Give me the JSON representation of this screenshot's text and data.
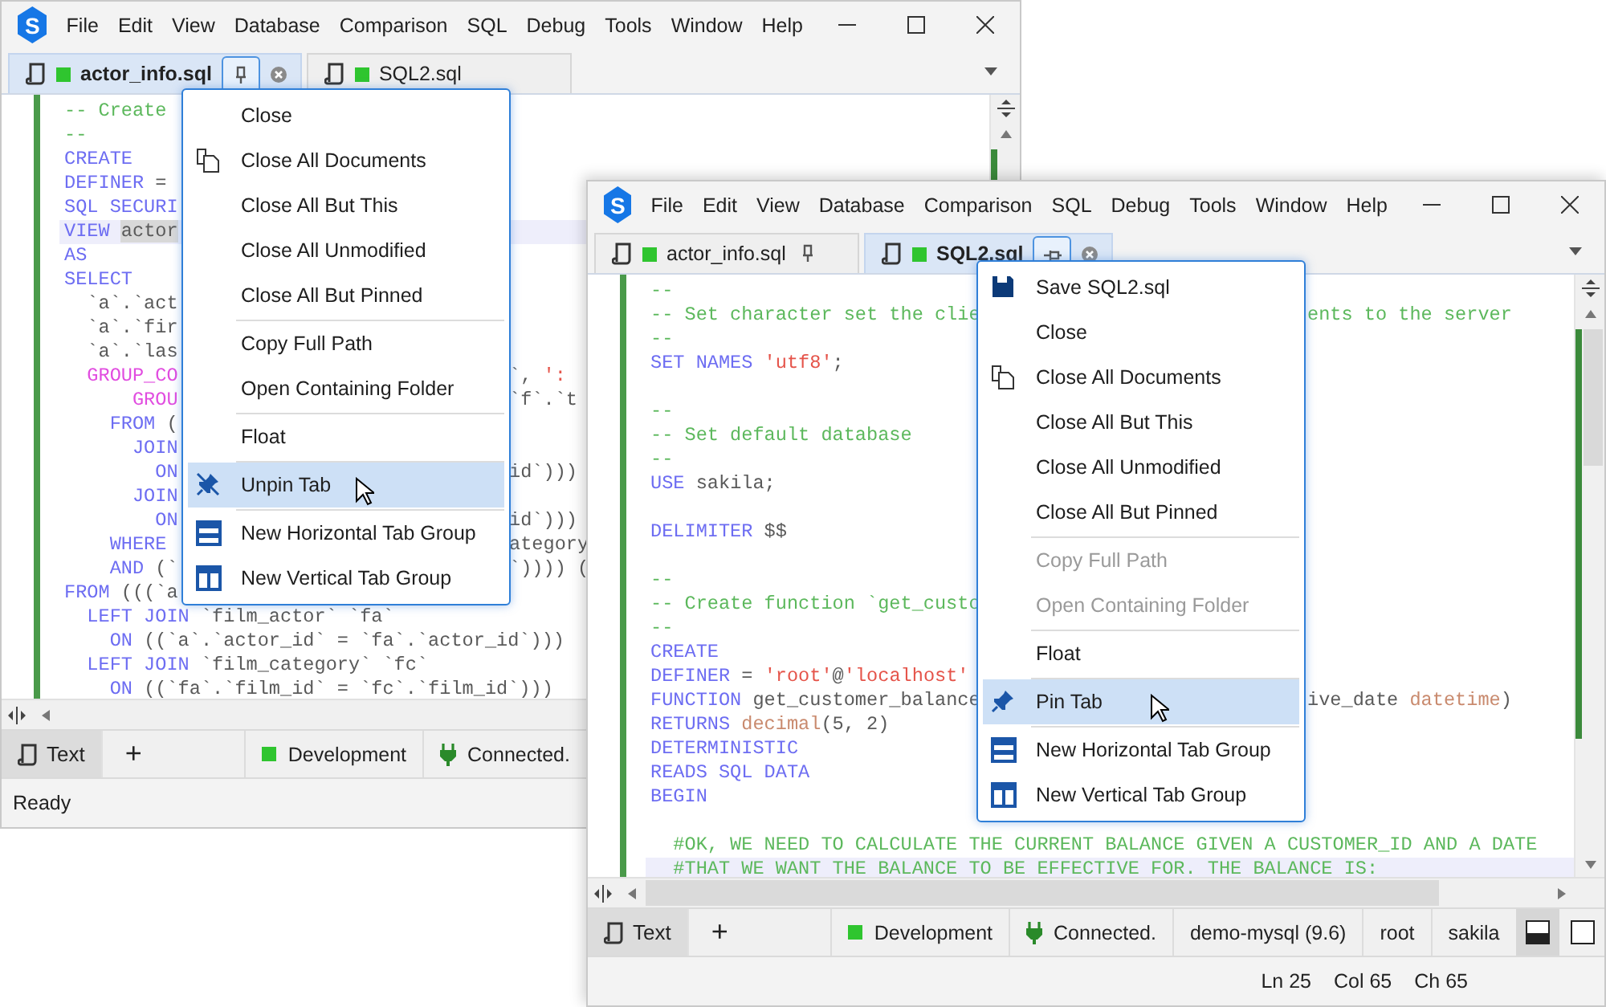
{
  "windows": [
    {
      "logo": "S",
      "menu": [
        "File",
        "Edit",
        "View",
        "Database",
        "Comparison",
        "SQL",
        "Debug",
        "Tools",
        "Window",
        "Help"
      ],
      "tabs": [
        {
          "label": "actor_info.sql",
          "selected": true,
          "pinned": true
        },
        {
          "label": "SQL2.sql",
          "selected": false,
          "pinned": false
        }
      ],
      "code": [
        {
          "kind": "code",
          "current": false,
          "tokens": [
            {
              "kind": "cm",
              "text": "-- Create"
            }
          ]
        },
        {
          "kind": "code",
          "current": false,
          "tokens": [
            {
              "kind": "cm",
              "text": "--"
            }
          ]
        },
        {
          "kind": "code",
          "current": false,
          "tokens": [
            {
              "kind": "kw",
              "text": "CREATE"
            }
          ]
        },
        {
          "kind": "code",
          "current": false,
          "tokens": [
            {
              "kind": "kw",
              "text": "DEFINER"
            },
            {
              "kind": "id",
              "text": " ="
            }
          ]
        },
        {
          "kind": "code",
          "current": false,
          "tokens": [
            {
              "kind": "kw",
              "text": "SQL SECURI"
            }
          ]
        },
        {
          "kind": "code",
          "current": true,
          "tokens": [
            {
              "kind": "kw",
              "text": "VIEW "
            },
            {
              "kind": "sel",
              "text": "actor"
            }
          ]
        },
        {
          "kind": "code",
          "current": false,
          "tokens": [
            {
              "kind": "kw",
              "text": "AS"
            }
          ]
        },
        {
          "kind": "code",
          "current": false,
          "tokens": [
            {
              "kind": "kw",
              "text": "SELECT"
            }
          ]
        },
        {
          "kind": "code",
          "current": false,
          "tokens": [
            {
              "kind": "id",
              "text": "  `a`.`act"
            }
          ]
        },
        {
          "kind": "code",
          "current": false,
          "tokens": [
            {
              "kind": "id",
              "text": "  `a`.`fir"
            }
          ]
        },
        {
          "kind": "code",
          "current": false,
          "tokens": [
            {
              "kind": "id",
              "text": "  `a`.`las"
            }
          ]
        },
        {
          "kind": "code",
          "current": false,
          "tokens": [
            {
              "kind": "fn",
              "text": "  GROUP_CO"
            }
          ],
          "tokens_right": [
            {
              "kind": "id",
              "text": "`, "
            },
            {
              "kind": "str",
              "text": "':"
            }
          ]
        },
        {
          "kind": "code",
          "current": false,
          "tokens": [
            {
              "kind": "fn",
              "text": "      GROU"
            }
          ],
          "tokens_right": [
            {
              "kind": "id",
              "text": "`f`.`t"
            }
          ]
        },
        {
          "kind": "code",
          "current": false,
          "tokens": [
            {
              "kind": "kw",
              "text": "    FROM"
            },
            {
              "kind": "id",
              "text": " ("
            }
          ]
        },
        {
          "kind": "code",
          "current": false,
          "tokens": [
            {
              "kind": "kw",
              "text": "      JOIN"
            }
          ]
        },
        {
          "kind": "code",
          "current": false,
          "tokens": [
            {
              "kind": "kw",
              "text": "        ON"
            }
          ],
          "tokens_right": [
            {
              "kind": "id",
              "text": "id`)))"
            }
          ]
        },
        {
          "kind": "code",
          "current": false,
          "tokens": [
            {
              "kind": "kw",
              "text": "      JOIN"
            }
          ]
        },
        {
          "kind": "code",
          "current": false,
          "tokens": [
            {
              "kind": "kw",
              "text": "        ON"
            }
          ],
          "tokens_right": [
            {
              "kind": "id",
              "text": "id`)))"
            }
          ]
        },
        {
          "kind": "code",
          "current": false,
          "tokens": [
            {
              "kind": "kw",
              "text": "    WHERE"
            }
          ],
          "tokens_right": [
            {
              "kind": "id",
              "text": "ategory"
            }
          ]
        },
        {
          "kind": "code",
          "current": false,
          "tokens": [
            {
              "kind": "kw",
              "text": "    AND"
            },
            {
              "kind": "id",
              "text": " (`"
            }
          ],
          "tokens_right": [
            {
              "kind": "id",
              "text": "`)))) ("
            }
          ]
        },
        {
          "kind": "code",
          "current": false,
          "tokens": [
            {
              "kind": "kw",
              "text": "FROM"
            },
            {
              "kind": "id",
              "text": " (((`a"
            }
          ]
        },
        {
          "kind": "code",
          "current": false,
          "tokens": [
            {
              "kind": "kw",
              "text": "  LEFT JOIN"
            },
            {
              "kind": "id",
              "text": " `film_actor` `fa`"
            }
          ]
        },
        {
          "kind": "code",
          "current": false,
          "tokens": [
            {
              "kind": "kw",
              "text": "    ON"
            },
            {
              "kind": "id",
              "text": " ((`a`.`actor_id` = `fa`.`actor_id`)))"
            }
          ]
        },
        {
          "kind": "code",
          "current": false,
          "tokens": [
            {
              "kind": "kw",
              "text": "  LEFT JOIN"
            },
            {
              "kind": "id",
              "text": " `film_category` `fc`"
            }
          ]
        },
        {
          "kind": "code",
          "current": false,
          "tokens": [
            {
              "kind": "kw",
              "text": "    ON"
            },
            {
              "kind": "id",
              "text": " ((`fa`.`film_id` = `fc`.`film_id`)))"
            }
          ]
        }
      ],
      "context_menu": [
        {
          "kind": "plain",
          "label": "Close",
          "disabled": false,
          "highlighted": false
        },
        {
          "kind": "close_all",
          "label": "Close All Documents",
          "disabled": false,
          "highlighted": false
        },
        {
          "kind": "plain",
          "label": "Close All But This",
          "disabled": false,
          "highlighted": false
        },
        {
          "kind": "plain",
          "label": "Close All Unmodified",
          "disabled": false,
          "highlighted": false
        },
        {
          "kind": "plain",
          "label": "Close All But Pinned",
          "disabled": false,
          "highlighted": false
        },
        {
          "kind": "separator"
        },
        {
          "kind": "plain",
          "label": "Copy Full Path",
          "disabled": false,
          "highlighted": false
        },
        {
          "kind": "plain",
          "label": "Open Containing Folder",
          "disabled": false,
          "highlighted": false
        },
        {
          "kind": "separator"
        },
        {
          "kind": "plain",
          "label": "Float",
          "disabled": false,
          "highlighted": false
        },
        {
          "kind": "separator"
        },
        {
          "kind": "unpin",
          "label": "Unpin Tab",
          "disabled": false,
          "highlighted": true
        },
        {
          "kind": "separator"
        },
        {
          "kind": "hsplit",
          "label": "New Horizontal Tab Group",
          "disabled": false,
          "highlighted": false
        },
        {
          "kind": "vsplit",
          "label": "New Vertical Tab Group",
          "disabled": false,
          "highlighted": false
        }
      ],
      "bottom_bar": [
        {
          "kind": "view",
          "label": "Text",
          "selected": true
        },
        {
          "kind": "add",
          "label": "+"
        },
        {
          "kind": "env",
          "label": "Development"
        },
        {
          "kind": "connection",
          "label": "Connected."
        }
      ],
      "status_bar": [
        {
          "kind": "left",
          "label": "Ready"
        }
      ]
    },
    {
      "logo": "S",
      "menu": [
        "File",
        "Edit",
        "View",
        "Database",
        "Comparison",
        "SQL",
        "Debug",
        "Tools",
        "Window",
        "Help"
      ],
      "tabs": [
        {
          "label": "actor_info.sql",
          "selected": false,
          "pinned": true
        },
        {
          "label": "SQL2.sql",
          "selected": true,
          "pinned": false
        }
      ],
      "code": [
        {
          "kind": "code",
          "current": false,
          "tokens": [
            {
              "kind": "cm",
              "text": "--"
            }
          ]
        },
        {
          "kind": "code",
          "current": false,
          "tokens": [
            {
              "kind": "cm",
              "text": "-- Set character set the clie"
            }
          ],
          "tokens_right": [
            {
              "kind": "cm",
              "text": "ents to the server"
            }
          ]
        },
        {
          "kind": "code",
          "current": false,
          "tokens": [
            {
              "kind": "cm",
              "text": "--"
            }
          ]
        },
        {
          "kind": "code",
          "current": false,
          "tokens": [
            {
              "kind": "kw",
              "text": "SET NAMES "
            },
            {
              "kind": "str",
              "text": "'utf8'"
            },
            {
              "kind": "id",
              "text": ";"
            }
          ]
        },
        {
          "kind": "blank",
          "current": false
        },
        {
          "kind": "code",
          "current": false,
          "tokens": [
            {
              "kind": "cm",
              "text": "--"
            }
          ]
        },
        {
          "kind": "code",
          "current": false,
          "tokens": [
            {
              "kind": "cm",
              "text": "-- Set default database"
            }
          ]
        },
        {
          "kind": "code",
          "current": false,
          "tokens": [
            {
              "kind": "cm",
              "text": "--"
            }
          ]
        },
        {
          "kind": "code",
          "current": false,
          "tokens": [
            {
              "kind": "kw",
              "text": "USE"
            },
            {
              "kind": "id",
              "text": " sakila;"
            }
          ]
        },
        {
          "kind": "blank",
          "current": false
        },
        {
          "kind": "code",
          "current": false,
          "tokens": [
            {
              "kind": "kw",
              "text": "DELIMITER"
            },
            {
              "kind": "id",
              "text": " $$"
            }
          ]
        },
        {
          "kind": "blank",
          "current": false
        },
        {
          "kind": "code",
          "current": false,
          "tokens": [
            {
              "kind": "cm",
              "text": "--"
            }
          ]
        },
        {
          "kind": "code",
          "current": false,
          "tokens": [
            {
              "kind": "cm",
              "text": "-- Create function `get_custo"
            }
          ]
        },
        {
          "kind": "code",
          "current": false,
          "tokens": [
            {
              "kind": "cm",
              "text": "--"
            }
          ]
        },
        {
          "kind": "code",
          "current": false,
          "tokens": [
            {
              "kind": "kw",
              "text": "CREATE"
            }
          ]
        },
        {
          "kind": "code",
          "current": false,
          "tokens": [
            {
              "kind": "kw",
              "text": "DEFINER"
            },
            {
              "kind": "id",
              "text": " = "
            },
            {
              "kind": "str",
              "text": "'root'"
            },
            {
              "kind": "id",
              "text": "@"
            },
            {
              "kind": "str",
              "text": "'localhost'"
            }
          ]
        },
        {
          "kind": "code",
          "current": false,
          "tokens": [
            {
              "kind": "kw",
              "text": "FUNCTION"
            },
            {
              "kind": "id",
              "text": " get_customer_balance"
            }
          ],
          "tokens_right": [
            {
              "kind": "id",
              "text": "ive_date "
            },
            {
              "kind": "ty",
              "text": "datetime"
            },
            {
              "kind": "id",
              "text": ")"
            }
          ]
        },
        {
          "kind": "code",
          "current": false,
          "tokens": [
            {
              "kind": "kw",
              "text": "RETURNS "
            },
            {
              "kind": "ty",
              "text": "decimal"
            },
            {
              "kind": "id",
              "text": "(5, 2)"
            }
          ]
        },
        {
          "kind": "code",
          "current": false,
          "tokens": [
            {
              "kind": "kw",
              "text": "DETERMINISTIC"
            }
          ]
        },
        {
          "kind": "code",
          "current": false,
          "tokens": [
            {
              "kind": "kw",
              "text": "READS SQL DATA"
            }
          ]
        },
        {
          "kind": "code",
          "current": false,
          "tokens": [
            {
              "kind": "kw",
              "text": "BEGIN"
            }
          ]
        },
        {
          "kind": "blank",
          "current": false
        },
        {
          "kind": "code",
          "current": false,
          "tokens": [
            {
              "kind": "cm",
              "text": "  #OK, WE NEED TO CALCULATE THE CURRENT BALANCE GIVEN A CUSTOMER_ID AND A DATE"
            }
          ]
        },
        {
          "kind": "code",
          "current": true,
          "tokens": [
            {
              "kind": "cm",
              "text": "  #THAT WE WANT THE BALANCE TO BE EFFECTIVE FOR. THE BALANCE IS:"
            }
          ]
        }
      ],
      "context_menu": [
        {
          "kind": "save",
          "label": "Save SQL2.sql",
          "disabled": false,
          "highlighted": false
        },
        {
          "kind": "plain",
          "label": "Close",
          "disabled": false,
          "highlighted": false
        },
        {
          "kind": "close_all",
          "label": "Close All Documents",
          "disabled": false,
          "highlighted": false
        },
        {
          "kind": "plain",
          "label": "Close All But This",
          "disabled": false,
          "highlighted": false
        },
        {
          "kind": "plain",
          "label": "Close All Unmodified",
          "disabled": false,
          "highlighted": false
        },
        {
          "kind": "plain",
          "label": "Close All But Pinned",
          "disabled": false,
          "highlighted": false
        },
        {
          "kind": "separator"
        },
        {
          "kind": "plain",
          "label": "Copy Full Path",
          "disabled": true,
          "highlighted": false
        },
        {
          "kind": "plain",
          "label": "Open Containing Folder",
          "disabled": true,
          "highlighted": false
        },
        {
          "kind": "separator"
        },
        {
          "kind": "plain",
          "label": "Float",
          "disabled": false,
          "highlighted": false
        },
        {
          "kind": "separator"
        },
        {
          "kind": "pin",
          "label": "Pin Tab",
          "disabled": false,
          "highlighted": true
        },
        {
          "kind": "separator"
        },
        {
          "kind": "hsplit",
          "label": "New Horizontal Tab Group",
          "disabled": false,
          "highlighted": false
        },
        {
          "kind": "vsplit",
          "label": "New Vertical Tab Group",
          "disabled": false,
          "highlighted": false
        }
      ],
      "bottom_bar": [
        {
          "kind": "view",
          "label": "Text",
          "selected": true
        },
        {
          "kind": "add",
          "label": "+"
        },
        {
          "kind": "env",
          "label": "Development"
        },
        {
          "kind": "connection",
          "label": "Connected."
        },
        {
          "kind": "text",
          "label": "demo-mysql (9.6)"
        },
        {
          "kind": "text",
          "label": "root"
        },
        {
          "kind": "text",
          "label": "sakila"
        },
        {
          "kind": "layout_split",
          "selected": true
        },
        {
          "kind": "layout_single",
          "selected": false
        }
      ],
      "status_bar": [
        {
          "kind": "right",
          "label": "Ln 25"
        },
        {
          "kind": "right",
          "label": "Col 65"
        },
        {
          "kind": "right",
          "label": "Ch 65"
        }
      ]
    }
  ]
}
